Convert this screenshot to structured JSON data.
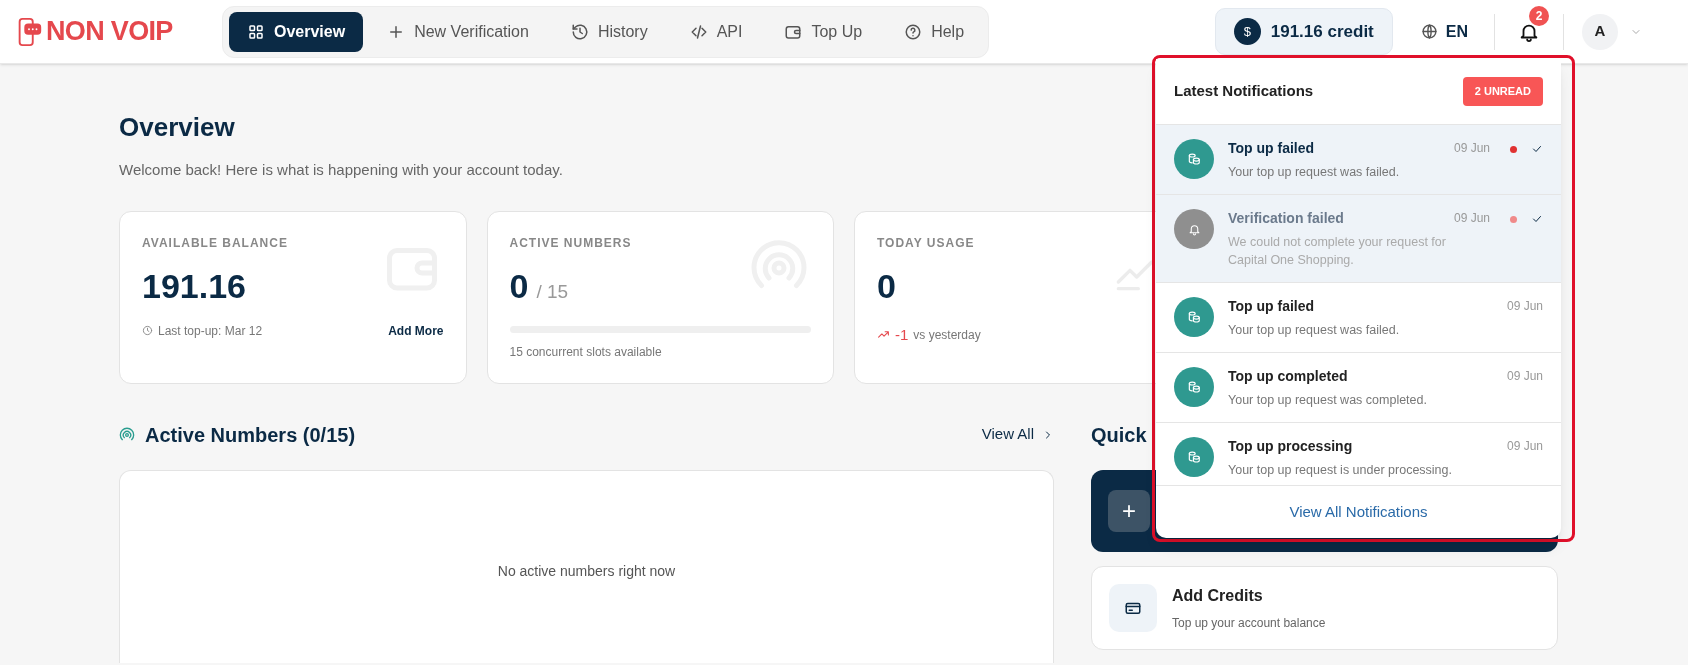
{
  "logo": {
    "text": "NON VOIP"
  },
  "nav": [
    {
      "label": "Overview",
      "selected": true
    },
    {
      "label": "New Verification",
      "selected": false
    },
    {
      "label": "History",
      "selected": false
    },
    {
      "label": "API",
      "selected": false
    },
    {
      "label": "Top Up",
      "selected": false
    },
    {
      "label": "Help",
      "selected": false
    }
  ],
  "credit": {
    "text": "191.16 credit",
    "symbol": "$"
  },
  "language": "EN",
  "notification_badge": "2",
  "avatar": {
    "initial": "A"
  },
  "page": {
    "title": "Overview",
    "subtitle": "Welcome back! Here is what is happening with your account today."
  },
  "stats": [
    {
      "kind": "balance",
      "label": "AVAILABLE BALANCE",
      "value": "191.16",
      "note": "Last top-up: Mar 12",
      "link": "Add More"
    },
    {
      "kind": "slots",
      "label": "ACTIVE NUMBERS",
      "value": "0",
      "suffix": "/ 15",
      "level": 0,
      "note": "15 concurrent slots available"
    },
    {
      "kind": "trend",
      "label": "TODAY USAGE",
      "value": "0",
      "change": "-1",
      "note": "vs yesterday"
    }
  ],
  "active_numbers": {
    "title": "Active Numbers (0/15)",
    "view_all": "View All",
    "empty": "No active numbers right now"
  },
  "quick": {
    "title": "Quick",
    "add_symbol": "+",
    "actions": [
      {
        "title": "Add Credits",
        "subtitle": "Top up your account balance"
      }
    ]
  },
  "notifications": {
    "title": "Latest Notifications",
    "unread": "2 UNREAD",
    "footer": "View All Notifications",
    "items": [
      {
        "kind": "coins",
        "title": "Top up failed",
        "body": "Your top up request was failed.",
        "date": "09 Jun",
        "unread": true,
        "muted": false
      },
      {
        "kind": "bell",
        "title": "Verification failed",
        "body": "We could not complete your request for Capital One Shopping.",
        "date": "09 Jun",
        "unread": true,
        "muted": true
      },
      {
        "kind": "coins",
        "title": "Top up failed",
        "body": "Your top up request was failed.",
        "date": "09 Jun",
        "unread": false,
        "muted": false
      },
      {
        "kind": "coins",
        "title": "Top up completed",
        "body": "Your top up request was completed.",
        "date": "09 Jun",
        "unread": false,
        "muted": false
      },
      {
        "kind": "coins",
        "title": "Top up processing",
        "body": "Your top up request is under processing.",
        "date": "09 Jun",
        "unread": false,
        "muted": false
      }
    ]
  }
}
